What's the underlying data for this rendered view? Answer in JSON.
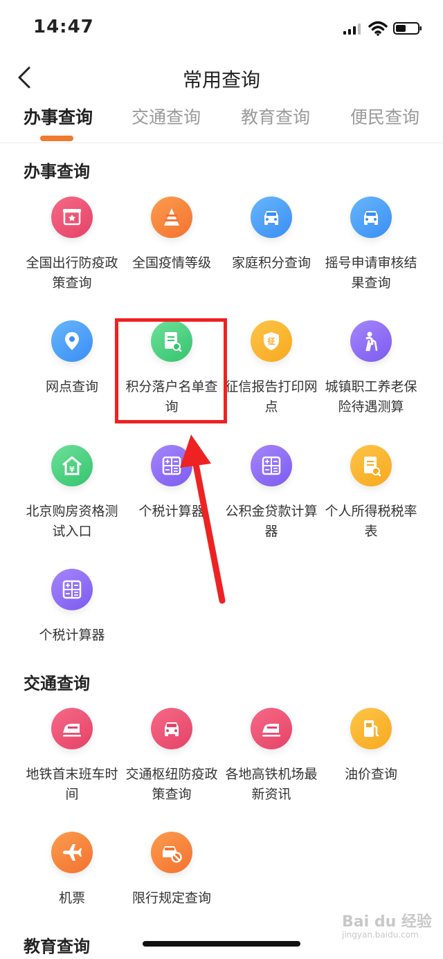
{
  "status_bar": {
    "time": "14:47"
  },
  "header": {
    "title": "常用查询"
  },
  "tabs": [
    {
      "label": "办事查询"
    },
    {
      "label": "交通查询"
    },
    {
      "label": "教育查询"
    },
    {
      "label": "便民查询"
    }
  ],
  "sections": {
    "banshi": {
      "title": "办事查询",
      "items": [
        {
          "label": "全国出行防疫政策查询",
          "icon": "gift-box-icon"
        },
        {
          "label": "全国疫情等级",
          "icon": "traffic-cone-icon"
        },
        {
          "label": "家庭积分查询",
          "icon": "car-icon"
        },
        {
          "label": "摇号申请审核结果查询",
          "icon": "car-icon"
        },
        {
          "label": "网点查询",
          "icon": "location-pin-icon"
        },
        {
          "label": "积分落户名单查询",
          "icon": "document-search-icon"
        },
        {
          "label": "征信报告打印网点",
          "icon": "credit-shield-icon"
        },
        {
          "label": "城镇职工养老保险待遇测算",
          "icon": "elderly-person-icon"
        },
        {
          "label": "北京购房资格测试入口",
          "icon": "house-yuan-icon"
        },
        {
          "label": "个税计算器",
          "icon": "calculator-icon"
        },
        {
          "label": "公积金贷款计算器",
          "icon": "calculator-icon"
        },
        {
          "label": "个人所得税税率表",
          "icon": "document-search-icon"
        },
        {
          "label": "个税计算器",
          "icon": "calculator-icon"
        }
      ]
    },
    "jiaotong": {
      "title": "交通查询",
      "items": [
        {
          "label": "地铁首末班车时间",
          "icon": "train-icon"
        },
        {
          "label": "交通枢纽防疫政策查询",
          "icon": "car-icon"
        },
        {
          "label": "各地高铁机场最新资讯",
          "icon": "train-icon"
        },
        {
          "label": "油价查询",
          "icon": "fuel-pump-icon"
        },
        {
          "label": "机票",
          "icon": "airplane-icon"
        },
        {
          "label": "限行规定查询",
          "icon": "restricted-car-icon"
        }
      ]
    },
    "jiaoyu": {
      "title": "教育查询"
    }
  },
  "watermark": {
    "brand": "Bai du 经验",
    "site": "jingyan.baidu.com"
  },
  "colors": {
    "accent": "#f07a2e",
    "highlight_box": "#ee2222",
    "red_icon": "#e54267",
    "orange_icon": "#f47230",
    "blue_icon": "#3a8ef4",
    "green_icon": "#34c46d",
    "yellow_icon": "#f8a91f",
    "purple_icon": "#7c5bf0"
  }
}
